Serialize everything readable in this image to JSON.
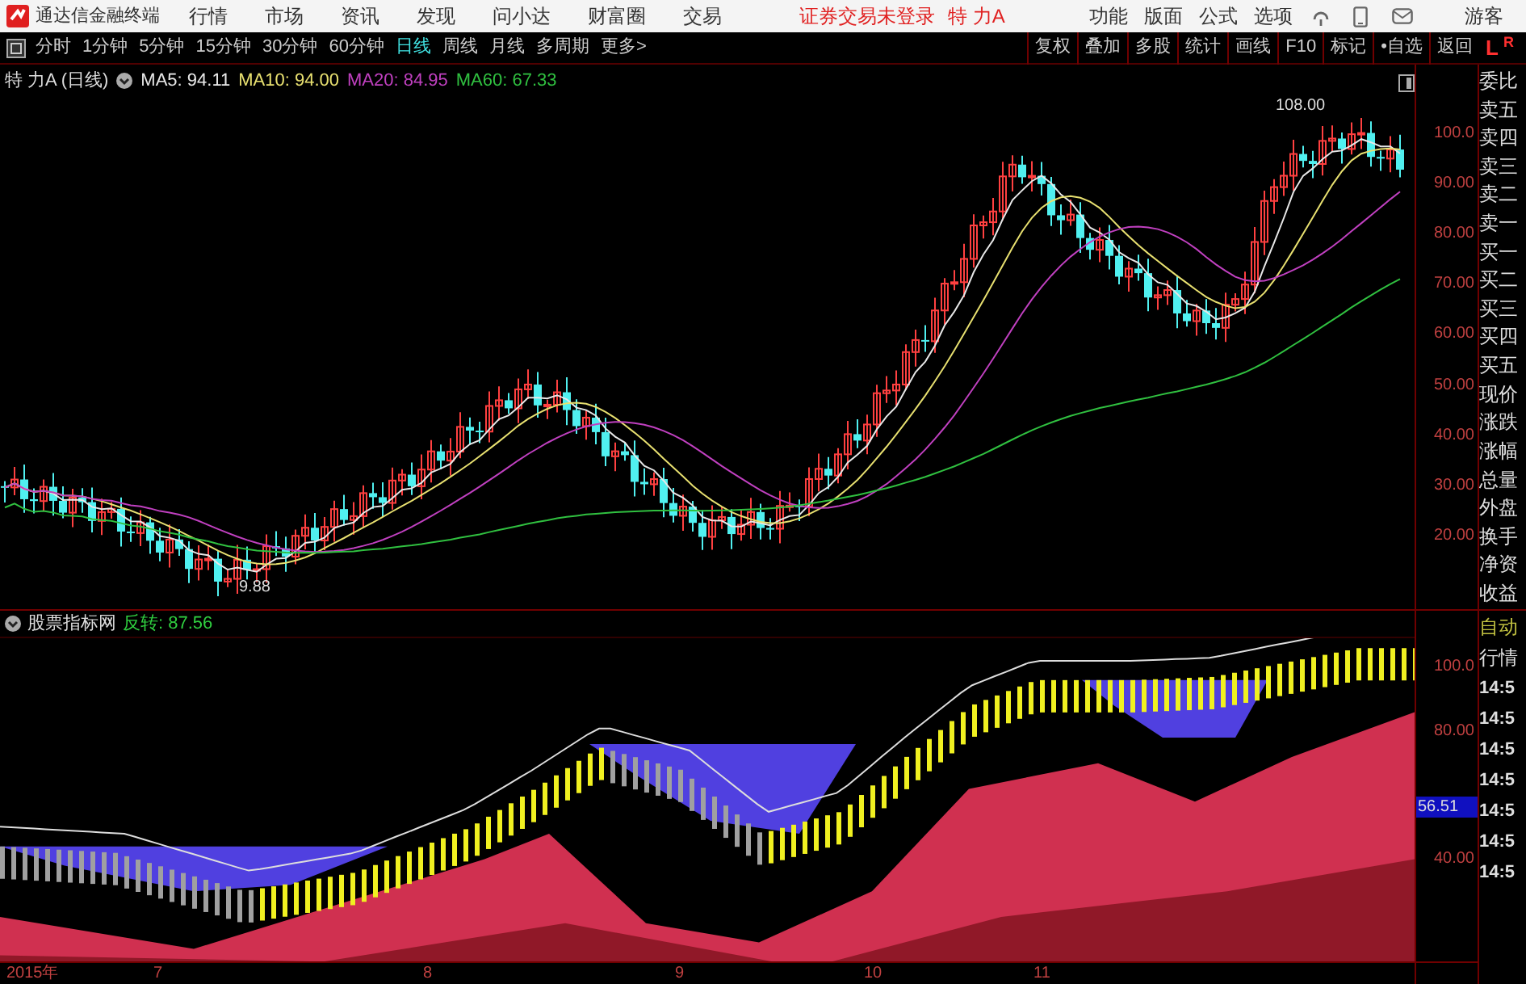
{
  "app_bar": {
    "app_name": "通达信金融终端",
    "menu": [
      "行情",
      "市场",
      "资讯",
      "发现",
      "问小达",
      "财富圈",
      "交易"
    ],
    "notice": "证券交易未登录",
    "stock": "特 力A",
    "tools": [
      "功能",
      "版面",
      "公式",
      "选项"
    ],
    "user": "游客"
  },
  "toolbar": {
    "periods": [
      {
        "label": "分时",
        "selected": false
      },
      {
        "label": "1分钟",
        "selected": false
      },
      {
        "label": "5分钟",
        "selected": false
      },
      {
        "label": "15分钟",
        "selected": false
      },
      {
        "label": "30分钟",
        "selected": false
      },
      {
        "label": "60分钟",
        "selected": false
      },
      {
        "label": "日线",
        "selected": true
      },
      {
        "label": "周线",
        "selected": false
      },
      {
        "label": "月线",
        "selected": false
      },
      {
        "label": "多周期",
        "selected": false
      }
    ],
    "more": "更多>",
    "buttons": [
      "复权",
      "叠加",
      "多股",
      "统计",
      "画线",
      "F10",
      "标记",
      "•自选",
      "返回"
    ],
    "flags": [
      "L",
      "R"
    ]
  },
  "main_chart": {
    "title": "特 力A (日线)",
    "indicators": [
      {
        "label": "MA5: 94.11",
        "color": "#e8e8e8"
      },
      {
        "label": "MA10: 94.00",
        "color": "#e8e070"
      },
      {
        "label": "MA20: 84.95",
        "color": "#c040c0"
      },
      {
        "label": "MA60: 67.33",
        "color": "#30c040"
      }
    ],
    "high_label": "108.00",
    "low_label": "9.88",
    "y_ticks": [
      "100.0",
      "90.00",
      "80.00",
      "70.00",
      "60.00",
      "50.00",
      "40.00",
      "30.00",
      "20.00"
    ]
  },
  "quote_labels": [
    "委比",
    "卖五",
    "卖四",
    "卖三",
    "卖二",
    "卖一",
    "买一",
    "买二",
    "买三",
    "买四",
    "买五",
    "现价",
    "涨跌",
    "涨幅",
    "总量",
    "外盘",
    "换手",
    "净资",
    "收益"
  ],
  "indicator_panel": {
    "title": "股票指标网",
    "reading": "反转: 87.56",
    "y_ticks": [
      "100.0",
      "80.00",
      "40.00"
    ],
    "current": "56.51"
  },
  "side_lower": {
    "mode": "自动",
    "label": "行情",
    "times": [
      "14:5",
      "14:5",
      "14:5",
      "14:5",
      "14:5",
      "14:5",
      "14:5"
    ]
  },
  "x_axis": [
    "2015年",
    "7",
    "8",
    "9",
    "10",
    "11"
  ]
}
